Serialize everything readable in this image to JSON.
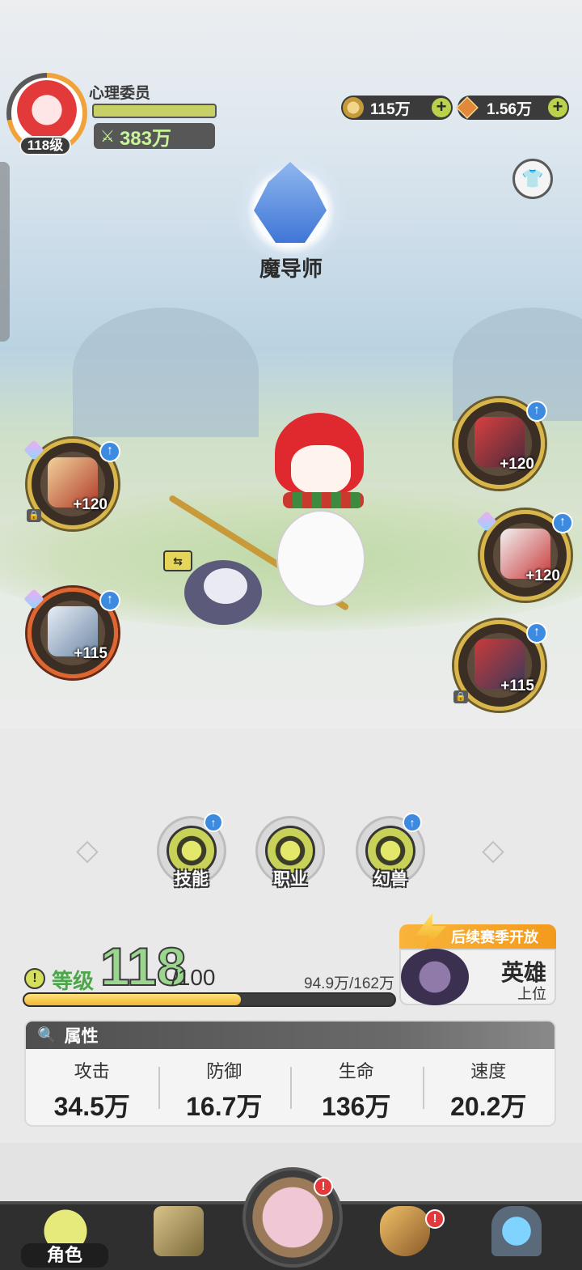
{
  "player": {
    "name": "心理委员",
    "level_badge": "118级",
    "power": "383万",
    "power_icon": "sword-power-icon"
  },
  "currencies": [
    {
      "icon": "gold-coin-icon",
      "value": "115万"
    },
    {
      "icon": "diamond-gem-icon",
      "value": "1.56万"
    }
  ],
  "class": {
    "name": "魔导师",
    "emblem_icon": "mage-crest-icon"
  },
  "equipment": {
    "left": [
      {
        "icon": "weapon-staff-icon",
        "enhance": "+120",
        "locked": true,
        "has_gem": true,
        "can_upgrade": true,
        "frame": "gold"
      },
      {
        "icon": "spellbook-icon",
        "enhance": "+115",
        "locked": false,
        "has_gem": true,
        "can_upgrade": true,
        "frame": "red"
      }
    ],
    "right": [
      {
        "icon": "helmet-icon",
        "enhance": "+120",
        "locked": false,
        "has_gem": false,
        "can_upgrade": true,
        "frame": "gold"
      },
      {
        "icon": "armor-icon",
        "enhance": "+120",
        "locked": false,
        "has_gem": true,
        "can_upgrade": true,
        "frame": "gold"
      },
      {
        "icon": "boots-icon",
        "enhance": "+115",
        "locked": true,
        "has_gem": false,
        "can_upgrade": true,
        "frame": "gold"
      }
    ]
  },
  "skills": [
    {
      "label": "技能",
      "icon": "skill-orbit-icon",
      "can_upgrade": true
    },
    {
      "label": "职业",
      "icon": "class-book-icon",
      "can_upgrade": false
    },
    {
      "label": "幻兽",
      "icon": "beast-cat-icon",
      "can_upgrade": true
    }
  ],
  "level": {
    "label": "等级",
    "value": "118",
    "max": "/100",
    "exp_text": "94.9万/162万",
    "exp_progress": 0.586
  },
  "season": {
    "banner": "后续赛季开放",
    "rank": "英雄",
    "sub": "上位"
  },
  "attributes": {
    "title": "属性",
    "items": [
      {
        "name": "攻击",
        "value": "34.5万"
      },
      {
        "name": "防御",
        "value": "16.7万"
      },
      {
        "name": "生命",
        "value": "136万"
      },
      {
        "name": "速度",
        "value": "20.2万"
      }
    ]
  },
  "nav": {
    "active_label": "角色",
    "items": [
      {
        "icon": "character-avatar-icon",
        "alert": false
      },
      {
        "icon": "quest-book-icon",
        "alert": false
      },
      {
        "icon": "home-cabin-icon",
        "alert": true
      },
      {
        "icon": "guild-shield-icon",
        "alert": true
      },
      {
        "icon": "portal-gate-icon",
        "alert": false
      }
    ]
  },
  "colors": {
    "accent_green": "#4da64a",
    "exp_gold": "#f0b634",
    "alert_red": "#e23a3a",
    "upgrade_blue": "#3c8be0"
  }
}
